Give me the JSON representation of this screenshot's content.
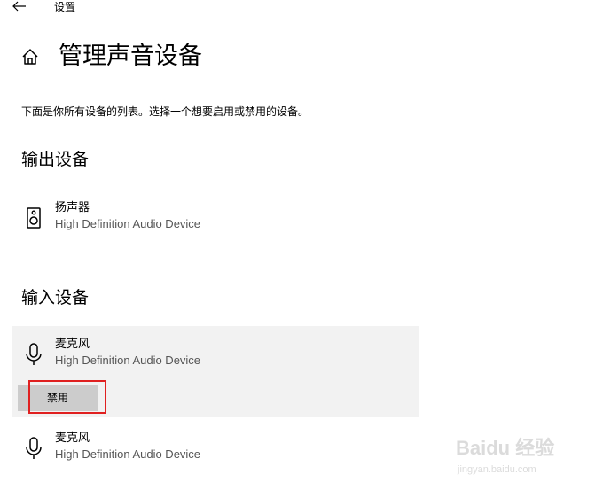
{
  "window": {
    "title": "设置"
  },
  "page": {
    "title": "管理声音设备",
    "description": "下面是你所有设备的列表。选择一个想要启用或禁用的设备。"
  },
  "output_section": {
    "heading": "输出设备",
    "devices": [
      {
        "name": "扬声器",
        "driver": "High Definition Audio Device",
        "icon": "speaker-icon"
      }
    ]
  },
  "input_section": {
    "heading": "输入设备",
    "devices": [
      {
        "name": "麦克风",
        "driver": "High Definition Audio Device",
        "icon": "microphone-icon",
        "selected": true,
        "action_label": "禁用"
      },
      {
        "name": "麦克风",
        "driver": "High Definition Audio Device",
        "icon": "microphone-icon",
        "selected": false
      }
    ]
  },
  "annotation": {
    "highlight_color": "#e02020"
  },
  "watermark": {
    "text": "Baidu 经验",
    "sub": "jingyan.baidu.com"
  }
}
